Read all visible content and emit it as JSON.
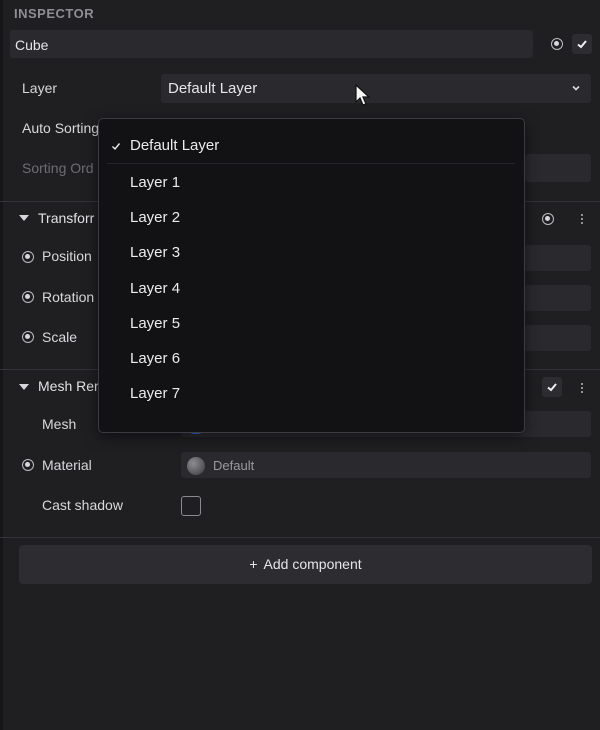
{
  "inspector": {
    "title": "INSPECTOR",
    "object_name": "Cube"
  },
  "properties": {
    "layer_label": "Layer",
    "layer_value": "Default Layer",
    "auto_sorting_label": "Auto Sorting",
    "sorting_order_label": "Sorting Ord"
  },
  "transform": {
    "title": "Transforr",
    "position_label": "Position",
    "rotation_label": "Rotation",
    "scale_label": "Scale"
  },
  "mesh_renderer": {
    "title": "Mesh Rer",
    "mesh_label": "Mesh",
    "material_label": "Material",
    "material_value": "Default",
    "cast_shadow_label": "Cast shadow",
    "cast_shadow_checked": false
  },
  "add_component": {
    "plus": "+",
    "label": "Add component"
  },
  "layer_dropdown": {
    "selected": "Default Layer",
    "items": [
      "Default Layer",
      "Layer 1",
      "Layer 2",
      "Layer 3",
      "Layer 4",
      "Layer 5",
      "Layer 6",
      "Layer 7"
    ]
  },
  "colors": {
    "background": "#1f1e21",
    "field": "#2a292d",
    "dropdown": "#121114",
    "accent_blue": "#2e6ee6"
  }
}
